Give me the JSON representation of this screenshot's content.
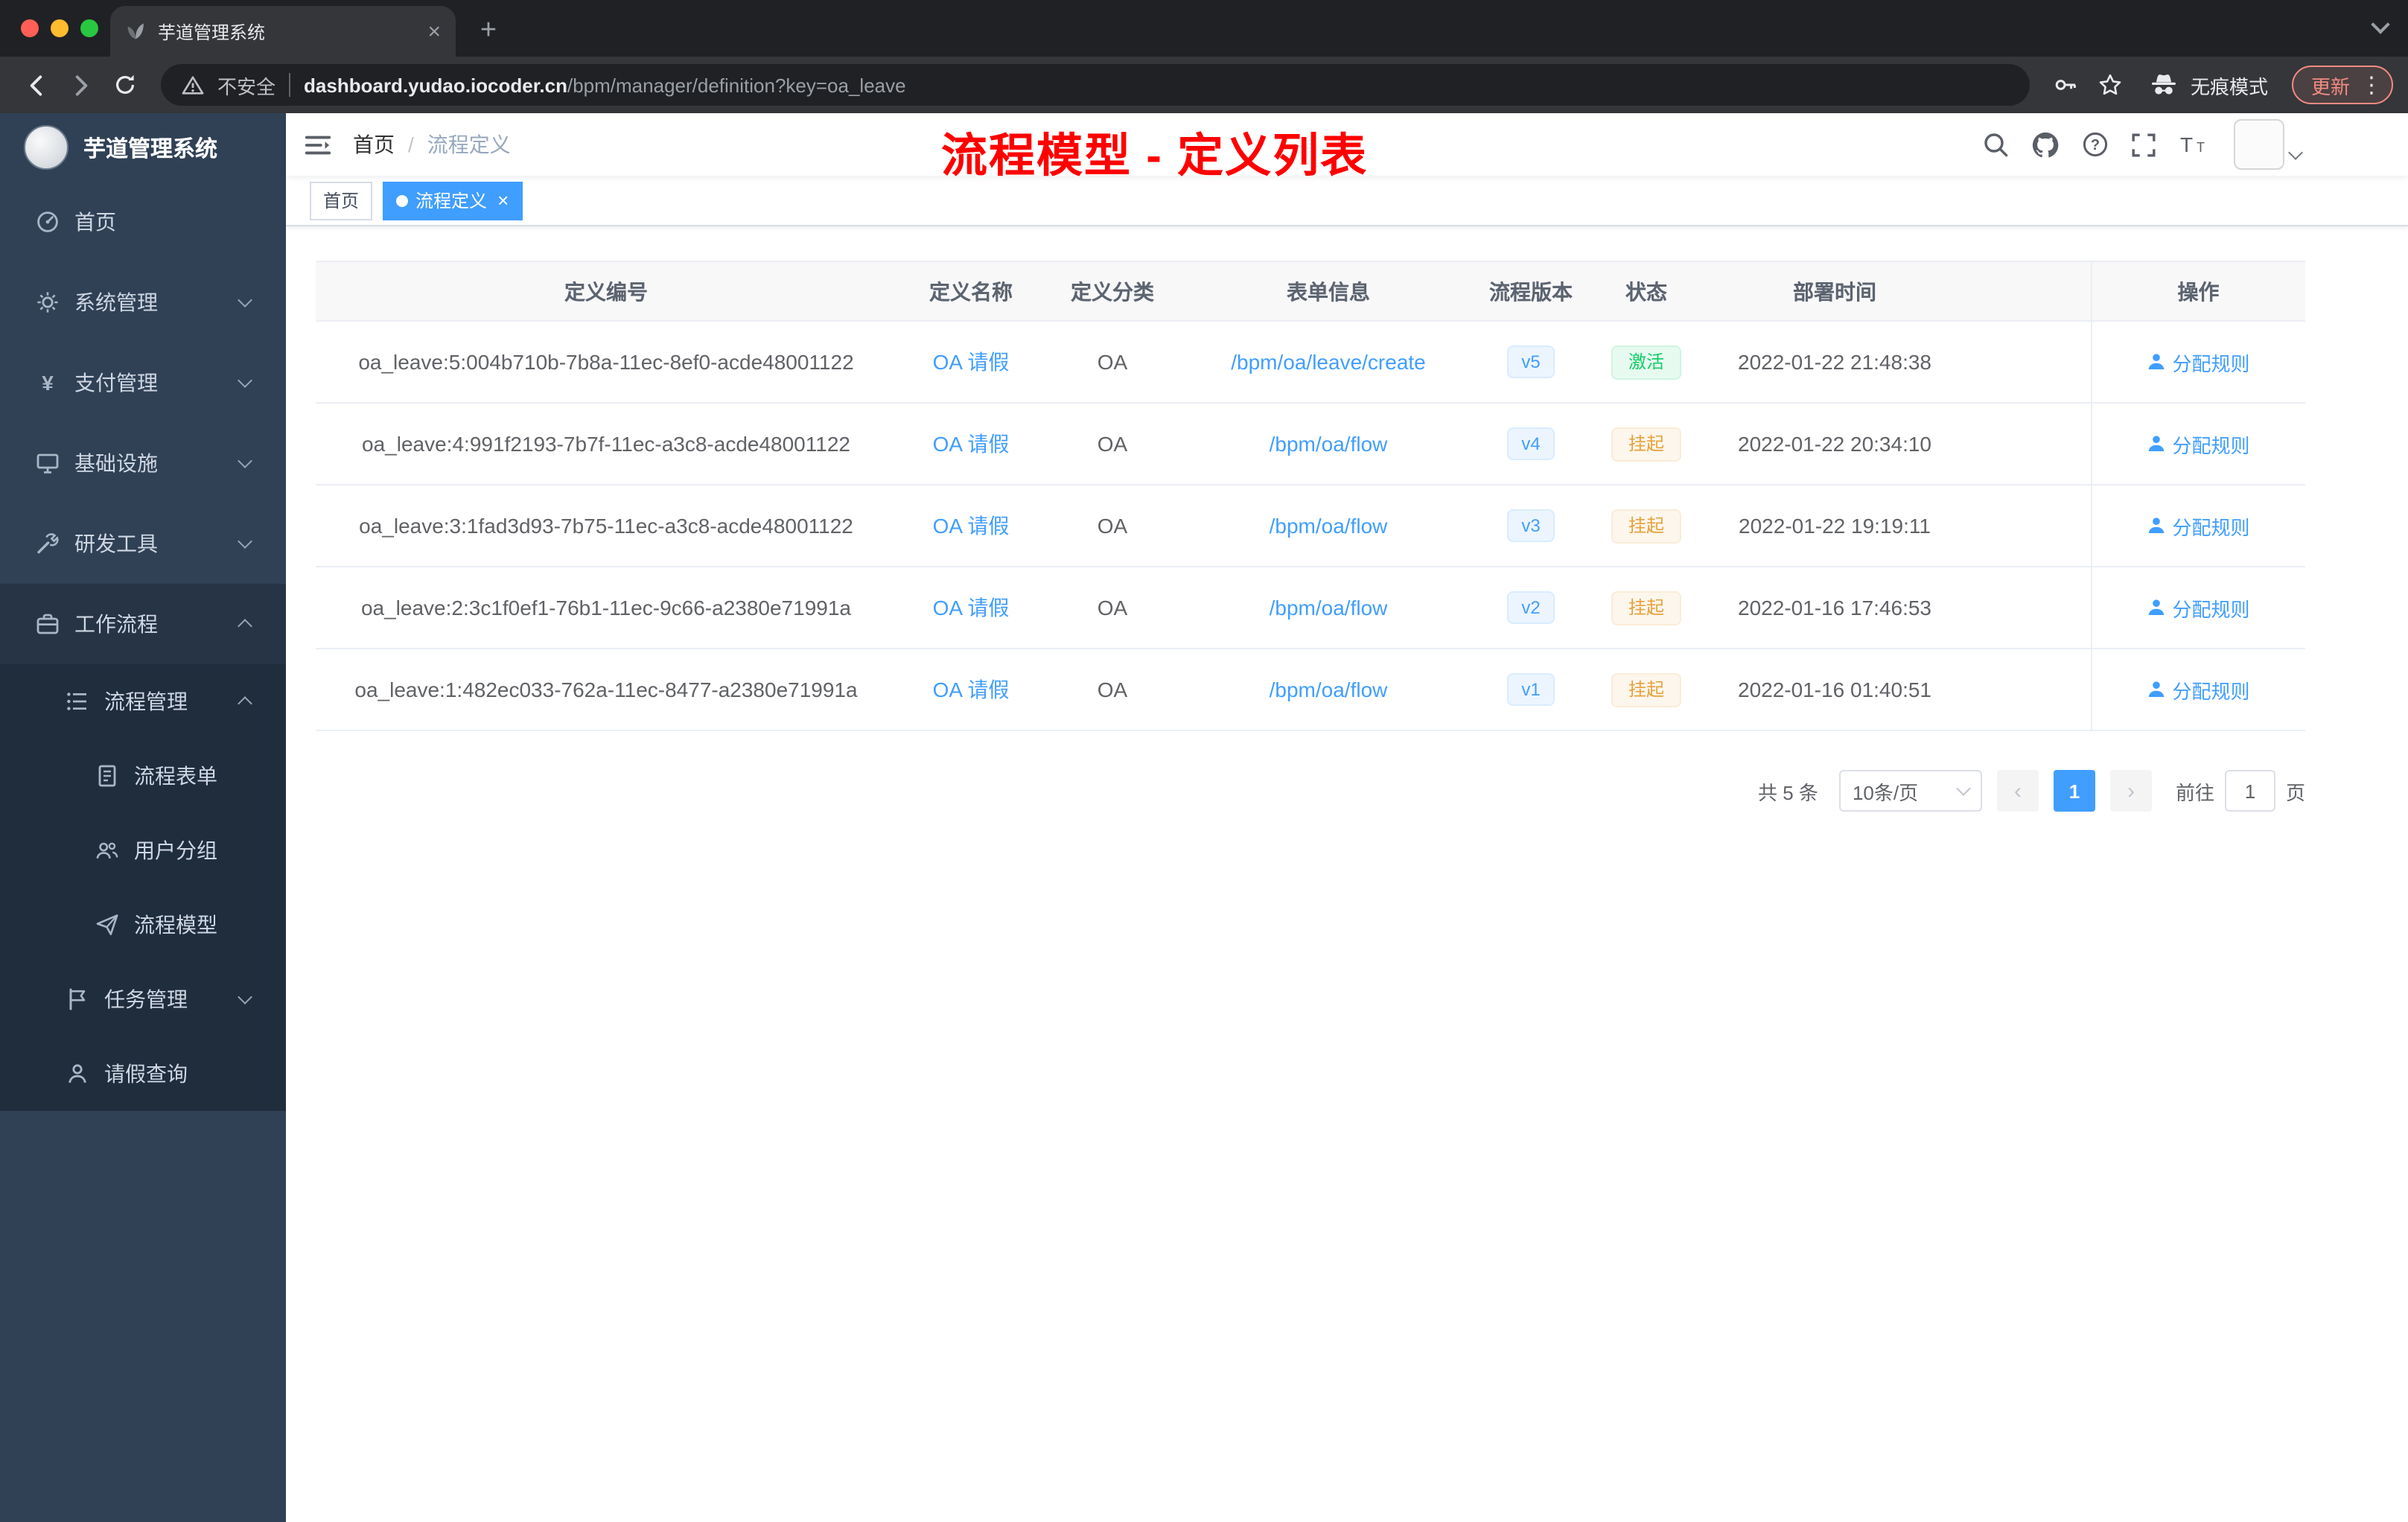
{
  "browser": {
    "tab_title": "芋道管理系统",
    "security_label": "不安全",
    "url_domain": "dashboard.yudao.iocoder.cn",
    "url_path": "/bpm/manager/definition?key=oa_leave",
    "incognito_label": "无痕模式",
    "update_label": "更新"
  },
  "sidebar": {
    "logo_title": "芋道管理系统",
    "items": [
      {
        "label": "首页",
        "icon": "dashboard-icon",
        "level": "lv1",
        "chevron": "none",
        "bg": "root"
      },
      {
        "label": "系统管理",
        "icon": "gear-icon",
        "level": "lv1",
        "chevron": "down",
        "bg": "root"
      },
      {
        "label": "支付管理",
        "icon": "yen-icon",
        "level": "lv1",
        "chevron": "down",
        "bg": "root"
      },
      {
        "label": "基础设施",
        "icon": "infrastructure-icon",
        "level": "lv1",
        "chevron": "down",
        "bg": "root"
      },
      {
        "label": "研发工具",
        "icon": "tools-icon",
        "level": "lv1",
        "chevron": "down",
        "bg": "root"
      },
      {
        "label": "工作流程",
        "icon": "briefcase-icon",
        "level": "lv1",
        "chevron": "up",
        "bg": "open"
      },
      {
        "label": "流程管理",
        "icon": "flow-icon",
        "level": "lv2",
        "chevron": "up",
        "bg": "sub"
      },
      {
        "label": "流程表单",
        "icon": "form-icon",
        "level": "lv3",
        "chevron": "none",
        "bg": "sub"
      },
      {
        "label": "用户分组",
        "icon": "users-icon",
        "level": "lv3",
        "chevron": "none",
        "bg": "sub"
      },
      {
        "label": "流程模型",
        "icon": "send-icon",
        "level": "lv3",
        "chevron": "none",
        "bg": "sub"
      },
      {
        "label": "任务管理",
        "icon": "task-icon",
        "level": "lv2",
        "chevron": "down",
        "bg": "sub"
      },
      {
        "label": "请假查询",
        "icon": "user-icon",
        "level": "lv2",
        "chevron": "none",
        "bg": "sub"
      }
    ]
  },
  "navbar": {
    "breadcrumb_home": "首页",
    "breadcrumb_sep": "/",
    "breadcrumb_current": "流程定义",
    "annotation": "流程模型 - 定义列表"
  },
  "tags": [
    {
      "label": "首页",
      "state": "inactive"
    },
    {
      "label": "流程定义",
      "state": "active"
    }
  ],
  "table": {
    "columns": [
      "定义编号",
      "定义名称",
      "定义分类",
      "表单信息",
      "流程版本",
      "状态",
      "部署时间",
      "操作"
    ],
    "rows": [
      {
        "id": "oa_leave:5:004b710b-7b8a-11ec-8ef0-acde48001122",
        "name": "OA 请假",
        "category": "OA",
        "form": "/bpm/oa/leave/create",
        "version": "v5",
        "status": "激活",
        "status_type": "success",
        "time": "2022-01-22 21:48:38",
        "action": "分配规则"
      },
      {
        "id": "oa_leave:4:991f2193-7b7f-11ec-a3c8-acde48001122",
        "name": "OA 请假",
        "category": "OA",
        "form": "/bpm/oa/flow",
        "version": "v4",
        "status": "挂起",
        "status_type": "warning",
        "time": "2022-01-22 20:34:10",
        "action": "分配规则"
      },
      {
        "id": "oa_leave:3:1fad3d93-7b75-11ec-a3c8-acde48001122",
        "name": "OA 请假",
        "category": "OA",
        "form": "/bpm/oa/flow",
        "version": "v3",
        "status": "挂起",
        "status_type": "warning",
        "time": "2022-01-22 19:19:11",
        "action": "分配规则"
      },
      {
        "id": "oa_leave:2:3c1f0ef1-76b1-11ec-9c66-a2380e71991a",
        "name": "OA 请假",
        "category": "OA",
        "form": "/bpm/oa/flow",
        "version": "v2",
        "status": "挂起",
        "status_type": "warning",
        "time": "2022-01-16 17:46:53",
        "action": "分配规则"
      },
      {
        "id": "oa_leave:1:482ec033-762a-11ec-8477-a2380e71991a",
        "name": "OA 请假",
        "category": "OA",
        "form": "/bpm/oa/flow",
        "version": "v1",
        "status": "挂起",
        "status_type": "warning",
        "time": "2022-01-16 01:40:51",
        "action": "分配规则"
      }
    ]
  },
  "pagination": {
    "total": "共 5 条",
    "page_size": "10条/页",
    "current_page": "1",
    "goto_label": "前往",
    "goto_value": "1",
    "goto_unit": "页"
  },
  "colors": {
    "accent": "#409eff",
    "success": "#13ce66",
    "warning": "#e6a23c",
    "annotation_red": "#ff0000",
    "sidebar_bg": "#304156",
    "submenu_bg": "#1f2d3d"
  }
}
